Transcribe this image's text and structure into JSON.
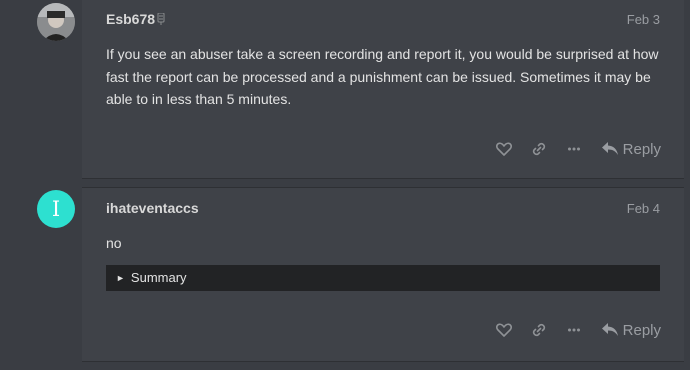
{
  "posts": [
    {
      "username": "Esb678",
      "date": "Feb 3",
      "text": "If you see an abuser take a screen recording and report it, you would be surprised at how fast the report can be processed and a punishment can be issued. Sometimes it may be able to in less than 5 minutes.",
      "actions": {
        "reply_label": "Reply"
      }
    },
    {
      "username": "ihateventaccs",
      "avatar_letter": "I",
      "date": "Feb 4",
      "text": "no",
      "summary_label": "Summary",
      "actions": {
        "reply_label": "Reply"
      }
    }
  ],
  "colors": {
    "background": "#3a3d43",
    "avatar2": "#2de0d0",
    "summary_bg": "#222325"
  }
}
